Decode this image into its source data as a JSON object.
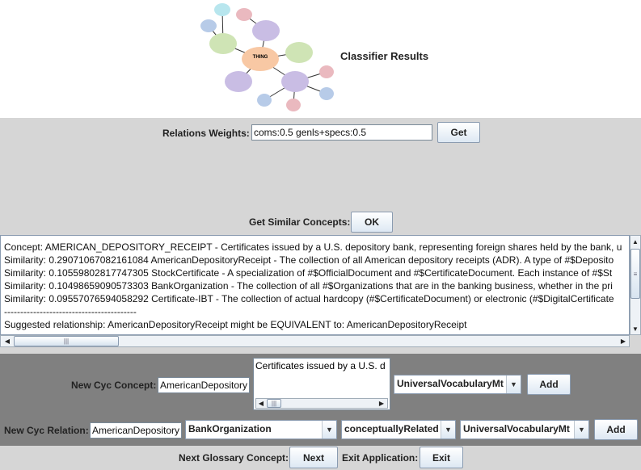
{
  "header": {
    "title": "Classifier Results",
    "logo_text": "THING"
  },
  "weights": {
    "label": "Relations Weights:",
    "value": "coms:0.5 genls+specs:0.5",
    "button": "Get"
  },
  "similar": {
    "label": "Get Similar Concepts:",
    "button": "OK"
  },
  "results": {
    "lines": [
      "Concept: AMERICAN_DEPOSITORY_RECEIPT - Certificates issued by a U.S. depository bank, representing foreign shares held by the bank, u",
      "Similarity: 0.29071067082161084 AmericanDepositoryReceipt - The collection of all American depository receipts (ADR). A type of #$Deposito",
      "Similarity: 0.10559802817747305 StockCertificate - A specialization of #$OfficialDocument and #$CertificateDocument.  Each instance of #$St",
      "Similarity: 0.10498659090573303 BankOrganization - The collection of all #$Organizations that are in the banking business, whether in the pri",
      "Similarity: 0.09557076594058292 Certificate-IBT - The collection of actual hardcopy (#$CertificateDocument) or electronic  (#$DigitalCertificate",
      "-----------------------------------------",
      "Suggested relationship: AmericanDepositoryReceipt might be EQUIVALENT to: AmericanDepositoryReceipt"
    ]
  },
  "new_concept": {
    "label": "New Cyc Concept:",
    "name": "AmericanDepository",
    "comment": "Certificates issued by a U.S. d",
    "mt": "UniversalVocabularyMt",
    "button": "Add"
  },
  "new_relation": {
    "label": "New Cyc Relation:",
    "name": "AmericanDepository",
    "target": "BankOrganization",
    "relation": "conceptuallyRelated",
    "mt": "UniversalVocabularyMt",
    "button": "Add"
  },
  "footer": {
    "next_label": "Next Glossary Concept:",
    "next_button": "Next",
    "exit_label": "Exit Application:",
    "exit_button": "Exit"
  }
}
